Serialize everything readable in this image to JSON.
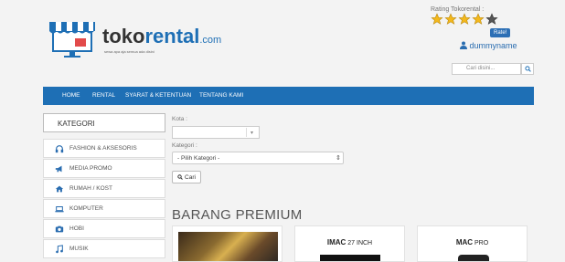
{
  "logo": {
    "name_part1": "toko",
    "name_part2": "rental",
    "name_part3": ".com",
    "tagline": "sewa apa aja semua ada disini"
  },
  "rating": {
    "label": "Rating Tokorental :",
    "stars_filled": 4,
    "stars_total": 5,
    "rate_button": "Rate!"
  },
  "user": {
    "name": "dummyname",
    "icon": "user-icon"
  },
  "search": {
    "placeholder": "Cari disini...",
    "icon": "search-icon"
  },
  "navbar": {
    "items": [
      "HOME",
      "RENTAL",
      "SYARAT & KETENTUAN",
      "TENTANG KAMI"
    ]
  },
  "sidebar": {
    "title": "KATEGORI",
    "items": [
      {
        "label": "FASHION & AKSESORIS",
        "icon": "headphones-icon"
      },
      {
        "label": "MEDIA PROMO",
        "icon": "megaphone-icon"
      },
      {
        "label": "RUMAH / KOST",
        "icon": "home-icon"
      },
      {
        "label": "KOMPUTER",
        "icon": "laptop-icon"
      },
      {
        "label": "HOBI",
        "icon": "camera-icon"
      },
      {
        "label": "MUSIK",
        "icon": "music-icon"
      }
    ]
  },
  "filter": {
    "kota_label": "Kota :",
    "kota_value": "",
    "kategori_label": "Kategori :",
    "kategori_value": "- Pilih Kategori -",
    "cari_button": "Cari"
  },
  "premium": {
    "title": "BARANG PREMIUM",
    "products": [
      {
        "title": ""
      },
      {
        "title_bold": "IMAC",
        "title_rest": " 27 INCH"
      },
      {
        "title_bold": "MAC",
        "title_rest": " PRO"
      }
    ]
  },
  "colors": {
    "brand_blue": "#1e6fb5",
    "star_gold": "#f3b81c",
    "star_empty": "#555555"
  }
}
